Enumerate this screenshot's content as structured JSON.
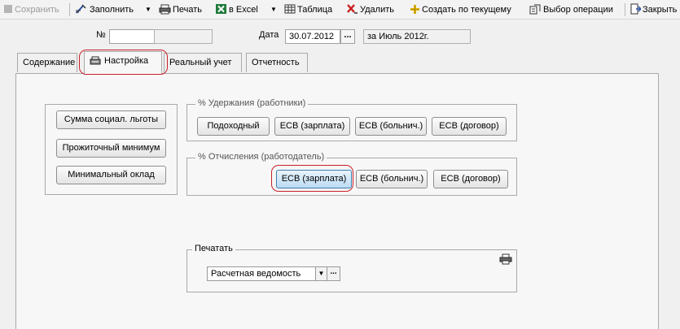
{
  "toolbar": {
    "save_label": "Сохранить",
    "fill_label": "Заполнить",
    "print_label": "Печать",
    "excel_label": "в Excel",
    "table_label": "Таблица",
    "delete_label": "Удалить",
    "create_label": "Создать по текущему",
    "select_op_label": "Выбор операции",
    "close_label": "Закрыть"
  },
  "header": {
    "number_label": "№",
    "number_value": "",
    "date_label": "Дата",
    "date_value": "30.07.2012",
    "date_dots": "...",
    "period_text": "за Июль 2012г."
  },
  "tabs": {
    "content": "Содержание",
    "settings": "Настройка",
    "accounting": "Реальный учет",
    "reports": "Отчетность",
    "active": "settings"
  },
  "left_buttons": {
    "social_benefit": "Сумма социал. льготы",
    "subsistence_min": "Прожиточный минимум",
    "min_salary": "Минимальный оклад"
  },
  "withholdings": {
    "title": "% Удержания (работники)",
    "income_tax": "Подоходный",
    "esv_salary": "ЕСВ (зарплата)",
    "esv_sick": "ЕСВ (больнич.)",
    "esv_contract": "ЕСВ (договор)"
  },
  "deductions": {
    "title": "% Отчисления (работодатель)",
    "esv_salary": "ЕСВ (зарплата)",
    "esv_sick": "ЕСВ (больнич.)",
    "esv_contract": "ЕСВ (договор)"
  },
  "print": {
    "title": "Печатать",
    "selected": "Расчетная ведомость",
    "dots": "..."
  },
  "colors": {
    "highlight_oval": "#c7202a",
    "pressed_button": "#bcdcf4"
  }
}
